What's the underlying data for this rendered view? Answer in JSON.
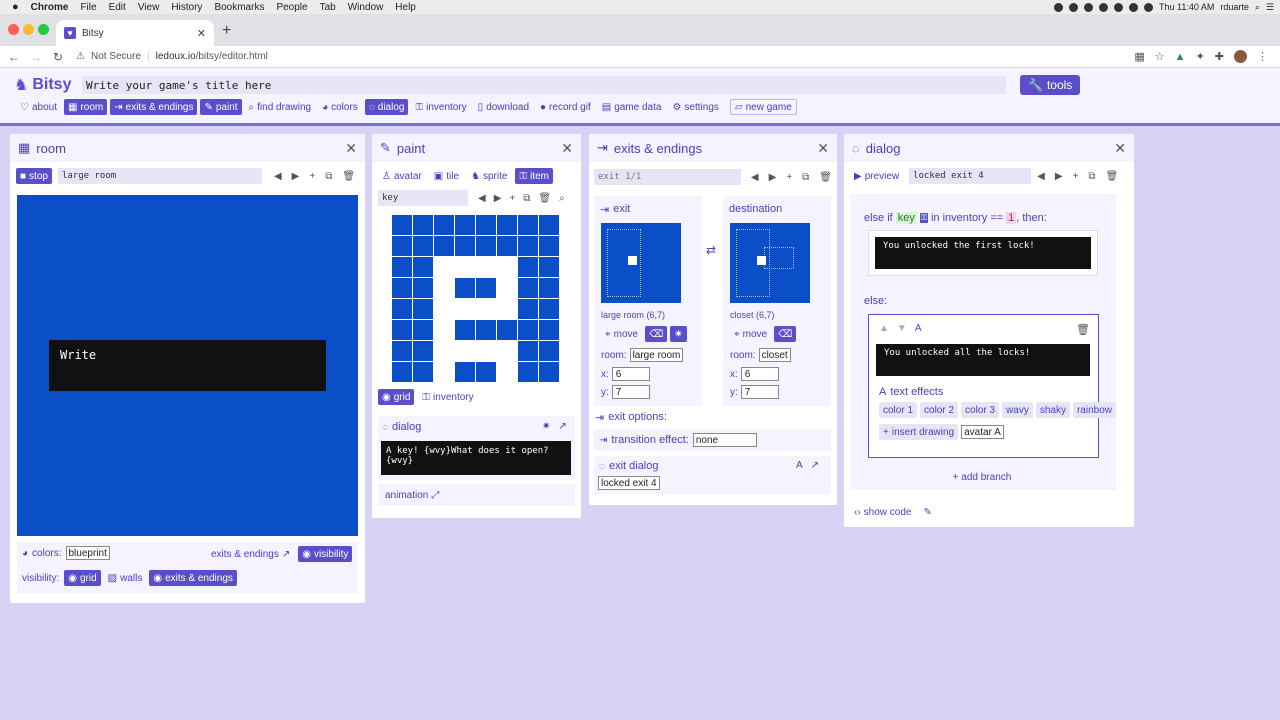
{
  "menubar": {
    "apple": "",
    "app": "Chrome",
    "items": [
      "File",
      "Edit",
      "View",
      "History",
      "Bookmarks",
      "People",
      "Tab",
      "Window",
      "Help"
    ],
    "clock": "Thu 11:40 AM",
    "user": "rduarte"
  },
  "browser": {
    "tab_title": "Bitsy",
    "security": "Not Secure",
    "url_host": "ledoux.io",
    "url_path": "/bitsy/editor.html"
  },
  "header": {
    "logo": "Bitsy",
    "title_placeholder": "Write your game's title here",
    "tools": "tools",
    "toolbar": [
      {
        "label": "about",
        "on": false
      },
      {
        "label": "room",
        "on": true
      },
      {
        "label": "exits & endings",
        "on": true
      },
      {
        "label": "paint",
        "on": true
      },
      {
        "label": "find drawing",
        "on": false
      },
      {
        "label": "colors",
        "on": false
      },
      {
        "label": "dialog",
        "on": true
      },
      {
        "label": "inventory",
        "on": false
      },
      {
        "label": "download",
        "on": false
      },
      {
        "label": "record gif",
        "on": false
      },
      {
        "label": "game data",
        "on": false
      },
      {
        "label": "settings",
        "on": false
      }
    ],
    "new_game": "new game"
  },
  "room": {
    "title": "room",
    "stop": "stop",
    "name": "large room",
    "dialog_preview": "Write",
    "colors_label": "colors:",
    "palette": "blueprint",
    "exits_link": "exits & endings",
    "visibility_btn": "visibility",
    "visibility_label": "visibility:",
    "vis_grid": "grid",
    "vis_walls": "walls",
    "vis_exits": "exits & endings"
  },
  "paint": {
    "title": "paint",
    "tabs": [
      "avatar",
      "tile",
      "sprite",
      "item"
    ],
    "name": "key",
    "grid_btn": "grid",
    "inventory_btn": "inventory",
    "dialog_label": "dialog",
    "dialog_text": "A key! {wvy}What does it open?{wvy}",
    "animation": "animation",
    "pixels": [
      "00000000",
      "00000000",
      "00111100",
      "00100100",
      "00111100",
      "00100000",
      "00111100",
      "00100100"
    ]
  },
  "exits": {
    "title": "exits & endings",
    "counter": "exit 1/1",
    "exit_label": "exit",
    "dest_label": "destination",
    "exit_room_caption": "large room (6,7)",
    "dest_room_caption": "closet (6,7)",
    "move": "move",
    "room_label": "room:",
    "exit_room": "large room",
    "dest_room": "closet",
    "x_label": "x:",
    "y_label": "y:",
    "exit_x": "6",
    "exit_y": "7",
    "dest_x": "6",
    "dest_y": "7",
    "options_label": "exit options:",
    "transition_label": "transition effect:",
    "transition": "none",
    "exit_dialog_label": "exit dialog",
    "exit_dialog": "locked exit 4"
  },
  "dialog": {
    "title": "dialog",
    "preview": "preview",
    "name": "locked exit 4",
    "branch_prefix": "else if",
    "branch_item": "key",
    "branch_mid": "in inventory ==",
    "branch_num": "1",
    "branch_suffix": ", then:",
    "text1": "You unlocked the first lock!",
    "else_label": "else:",
    "text2": "You unlocked all the locks!",
    "effects_label": "text effects",
    "effects": [
      "color 1",
      "color 2",
      "color 3",
      "wavy",
      "shaky",
      "rainbow"
    ],
    "insert_drawing": "insert drawing",
    "drawing_sel": "avatar A",
    "add_branch": "add branch",
    "show_code": "show code"
  }
}
